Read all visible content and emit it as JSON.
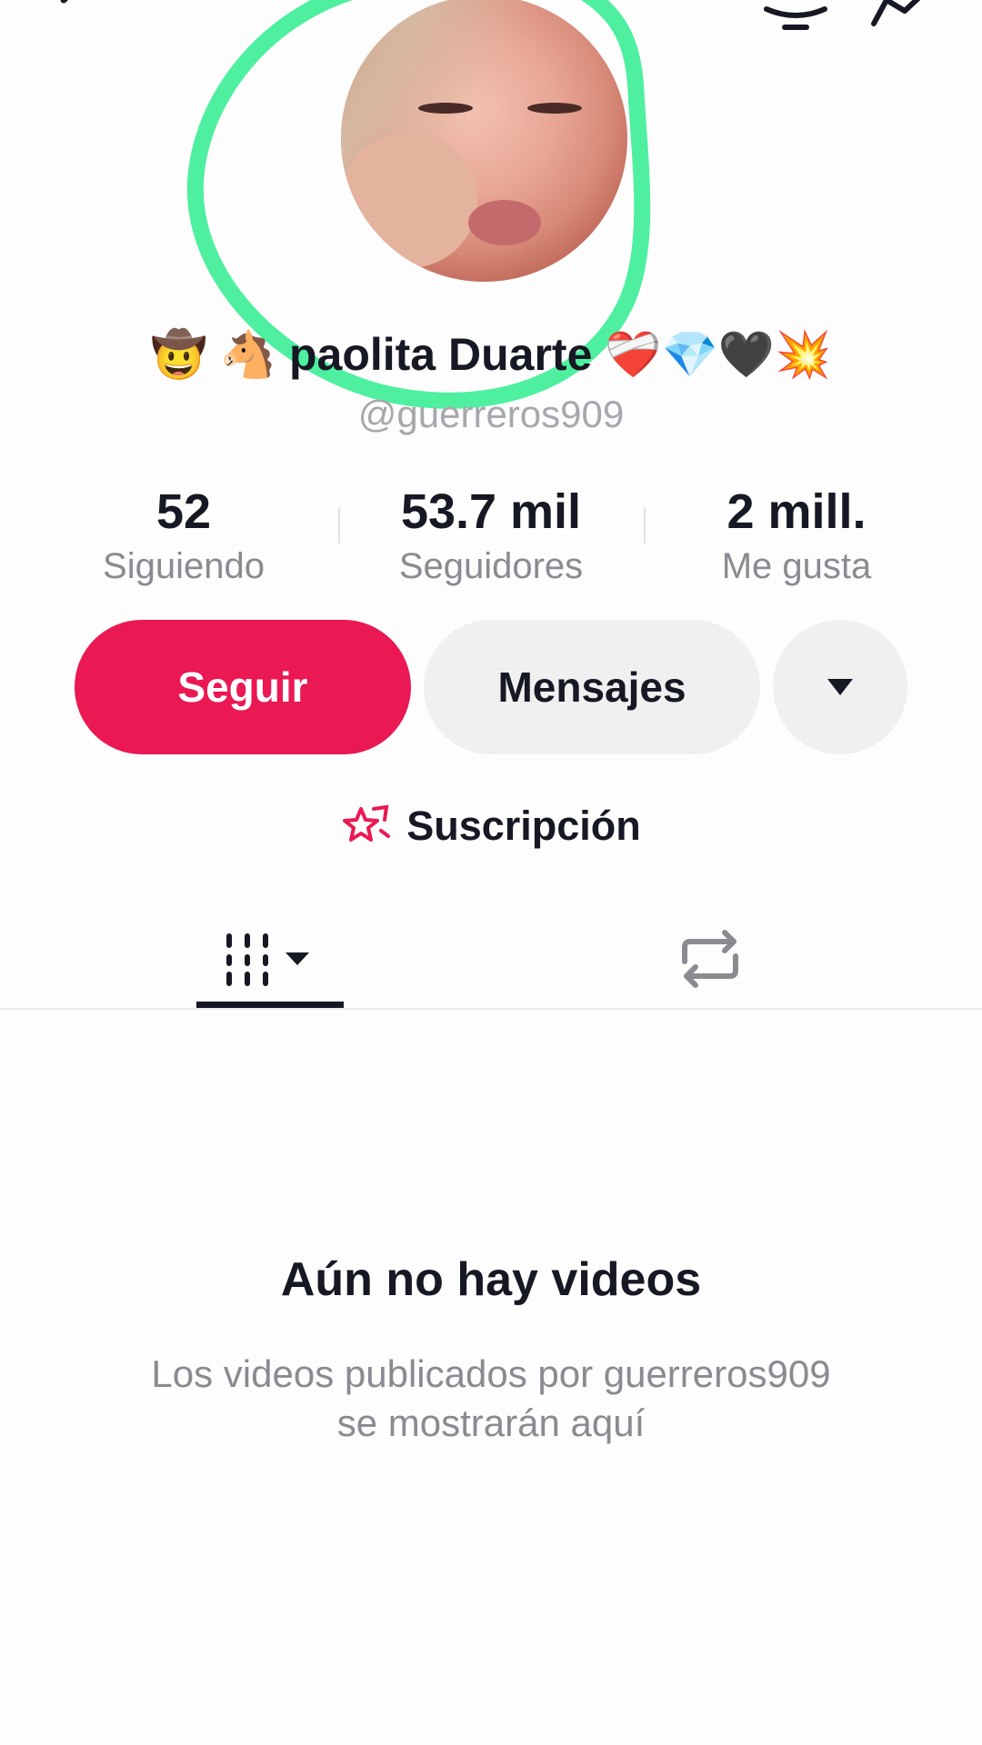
{
  "profile": {
    "name_prefix_emojis": "🤠 🐴",
    "name_text": "paolita Duarte",
    "name_suffix_emojis": "❤️‍🩹💎🖤💥",
    "handle": "@guerreros909"
  },
  "stats": [
    {
      "value": "52",
      "label": "Siguiendo"
    },
    {
      "value": "53.7 mil",
      "label": "Seguidores"
    },
    {
      "value": "2 mill.",
      "label": "Me gusta"
    }
  ],
  "actions": {
    "follow_label": "Seguir",
    "messages_label": "Mensajes",
    "more_icon": "triangle-down-icon"
  },
  "subscription": {
    "label": "Suscripción",
    "icon": "subscription-star-icon"
  },
  "tabs": {
    "videos_icon": "videos-grid-icon",
    "reposts_icon": "repost-icon"
  },
  "empty_state": {
    "title": "Aún no hay videos",
    "description": "Los videos publicados por guerreros909 se mostrarán aquí"
  },
  "colors": {
    "accent": "#ea1853",
    "highlight": "#4ef0a0"
  }
}
